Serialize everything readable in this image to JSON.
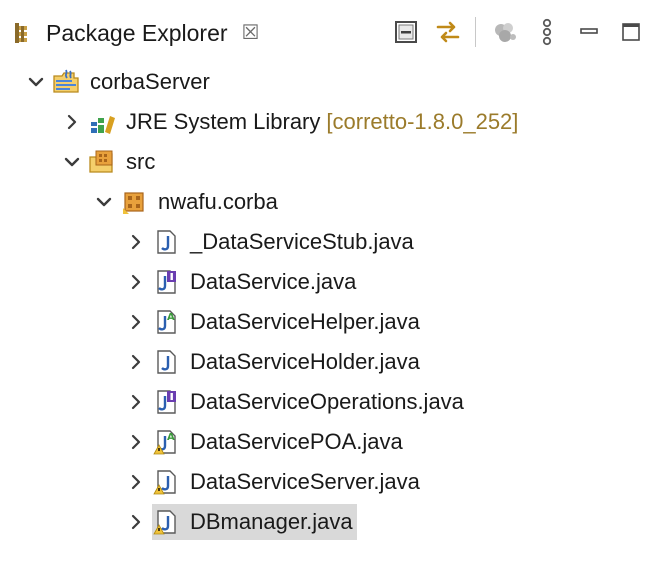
{
  "view": {
    "title": "Package Explorer",
    "close_glyph": "☒",
    "toolbar": [
      {
        "name": "collapse-all-icon"
      },
      {
        "name": "link-with-editor-icon"
      },
      {
        "name": "filters-icon"
      },
      {
        "name": "view-menu-icon"
      },
      {
        "name": "minimize-icon"
      },
      {
        "name": "maximize-icon"
      }
    ]
  },
  "tree": {
    "project": {
      "label": "corbaServer",
      "icon": "java-project-icon",
      "expanded": true
    },
    "jre": {
      "label": "JRE System Library",
      "decoration": "[corretto-1.8.0_252]",
      "icon": "library-icon",
      "expanded": false
    },
    "src": {
      "label": "src",
      "icon": "source-folder-icon",
      "expanded": true
    },
    "package": {
      "label": "nwafu.corba",
      "icon": "package-icon",
      "expanded": true
    },
    "files": [
      {
        "label": "_DataServiceStub.java",
        "icon": "java-class-file-icon"
      },
      {
        "label": "DataService.java",
        "icon": "java-interface-file-icon"
      },
      {
        "label": "DataServiceHelper.java",
        "icon": "java-abstract-class-file-icon"
      },
      {
        "label": "DataServiceHolder.java",
        "icon": "java-class-file-icon"
      },
      {
        "label": "DataServiceOperations.java",
        "icon": "java-interface-file-icon"
      },
      {
        "label": "DataServicePOA.java",
        "icon": "java-abstract-class-warning-file-icon"
      },
      {
        "label": "DataServiceServer.java",
        "icon": "java-class-warning-file-icon"
      },
      {
        "label": "DBmanager.java",
        "icon": "java-class-warning-file-icon",
        "selected": true
      }
    ]
  }
}
